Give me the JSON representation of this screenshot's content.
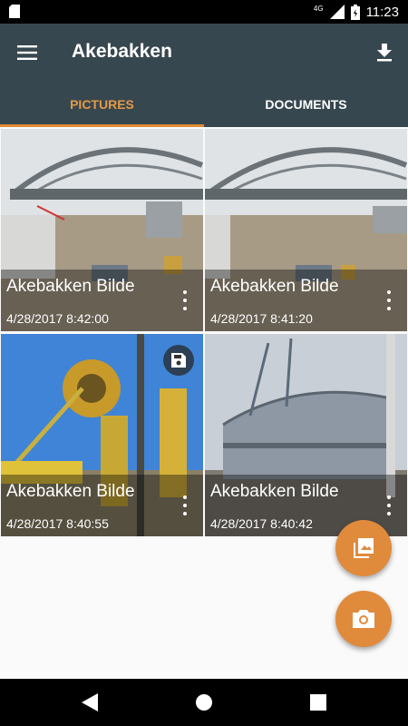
{
  "status_bar": {
    "network": "4G",
    "time": "11:23"
  },
  "app_bar": {
    "title": "Akebakken"
  },
  "tabs": [
    {
      "label": "PICTURES",
      "active": true
    },
    {
      "label": "DOCUMENTS",
      "active": false
    }
  ],
  "pictures": [
    {
      "name": "Akebakken Bilde",
      "date": "4/28/2017 8:42:00"
    },
    {
      "name": "Akebakken Bilde",
      "date": "4/28/2017 8:41:20"
    },
    {
      "name": "Akebakken Bilde",
      "date": "4/28/2017 8:40:55",
      "saved": true
    },
    {
      "name": "Akebakken Bilde",
      "date": "4/28/2017 8:40:42"
    }
  ],
  "colors": {
    "app_bar": "#37474f",
    "accent": "#e08a3c",
    "active_tab_text": "#e39a45"
  },
  "icons": [
    "sd-card-icon",
    "signal-icon",
    "battery-icon",
    "menu-icon",
    "download-icon",
    "more-vert-icon",
    "save-icon",
    "gallery-icon",
    "camera-icon",
    "back-icon",
    "home-icon",
    "recents-icon"
  ]
}
